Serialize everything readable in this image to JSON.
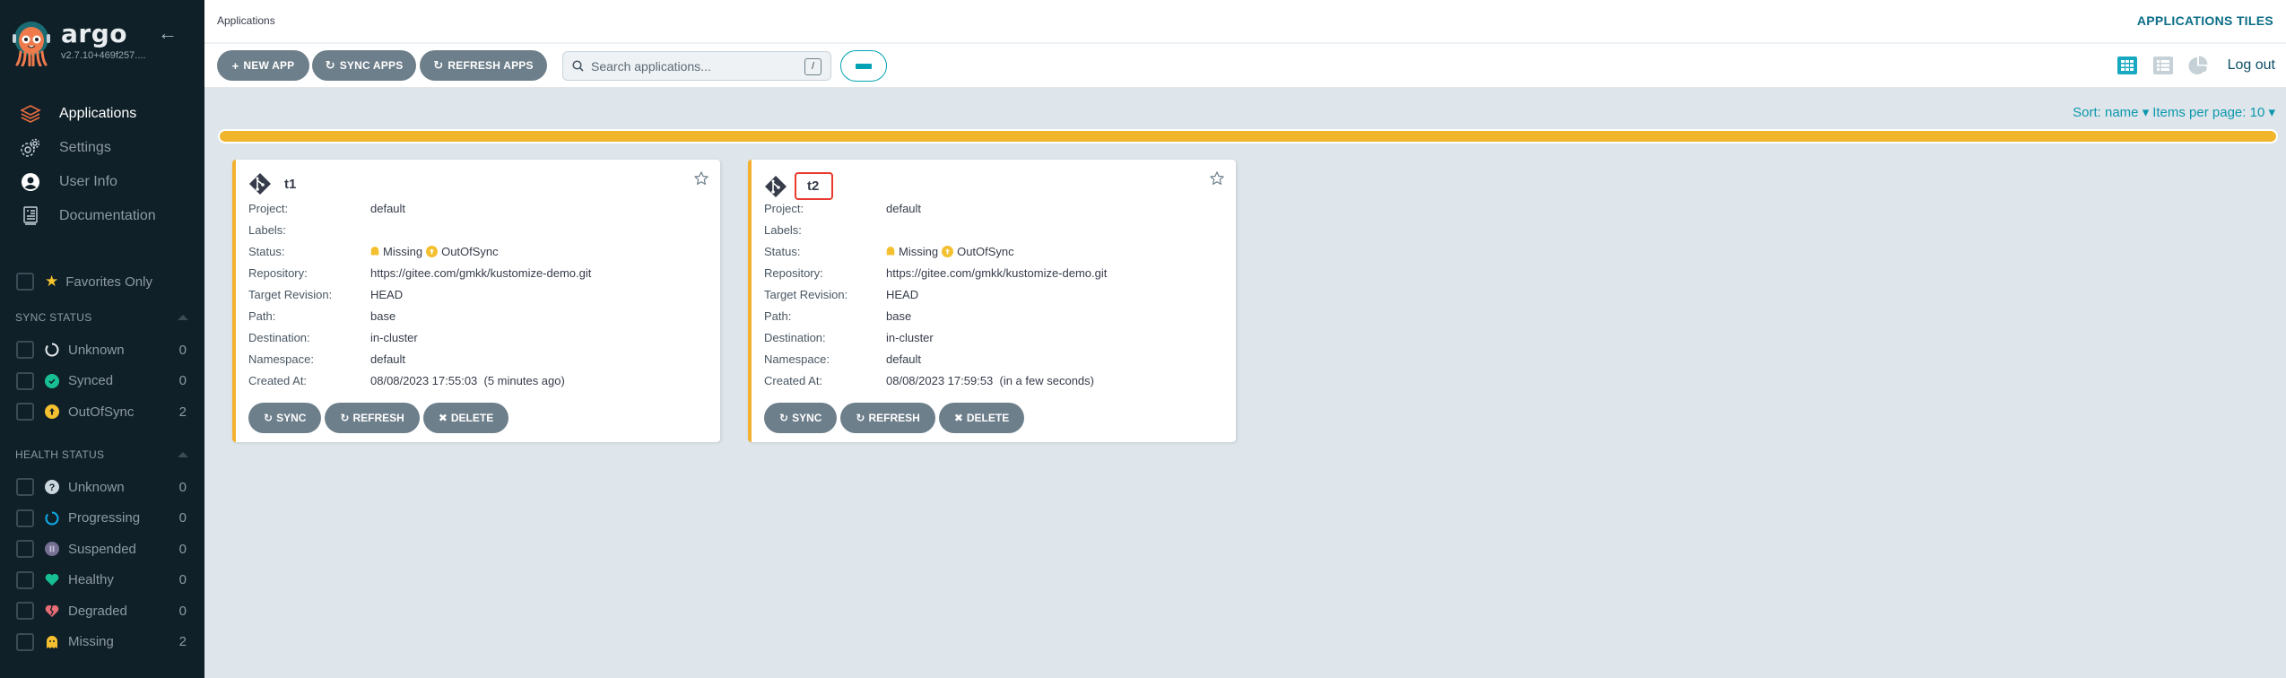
{
  "sidebar": {
    "brand": "argo",
    "version": "v2.7.10+469f257....",
    "nav": [
      {
        "label": "Applications",
        "icon": "layers-icon",
        "active": true
      },
      {
        "label": "Settings",
        "icon": "gears-icon",
        "active": false
      },
      {
        "label": "User Info",
        "icon": "user-circle-icon",
        "active": false
      },
      {
        "label": "Documentation",
        "icon": "book-icon",
        "active": false
      }
    ],
    "favorites_label": "Favorites Only",
    "sync_status": {
      "title": "SYNC STATUS",
      "items": [
        {
          "label": "Unknown",
          "count": "0",
          "icon": "circle-notch-icon"
        },
        {
          "label": "Synced",
          "count": "0",
          "icon": "check-circle-icon"
        },
        {
          "label": "OutOfSync",
          "count": "2",
          "icon": "arrow-circle-up-icon"
        }
      ]
    },
    "health_status": {
      "title": "HEALTH STATUS",
      "items": [
        {
          "label": "Unknown",
          "count": "0",
          "icon": "question-circle-icon"
        },
        {
          "label": "Progressing",
          "count": "0",
          "icon": "spinner-icon"
        },
        {
          "label": "Suspended",
          "count": "0",
          "icon": "pause-circle-icon"
        },
        {
          "label": "Healthy",
          "count": "0",
          "icon": "heart-icon"
        },
        {
          "label": "Degraded",
          "count": "0",
          "icon": "heart-broken-icon"
        },
        {
          "label": "Missing",
          "count": "2",
          "icon": "ghost-icon"
        }
      ]
    }
  },
  "topbar": {
    "breadcrumb": "Applications",
    "title": "APPLICATIONS TILES"
  },
  "toolbar": {
    "new_app": "NEW APP",
    "sync_apps": "SYNC APPS",
    "refresh_apps": "REFRESH APPS",
    "search_placeholder": "Search applications...",
    "search_value": "",
    "search_shortcut": "/",
    "logout": "Log out",
    "views": [
      "tiles",
      "list",
      "summary"
    ],
    "active_view": "tiles"
  },
  "content": {
    "sort_label": "Sort: name",
    "items_per_page_label": "Items per page: 10",
    "status_bar_color": "#f0b52a",
    "status_bar_fraction": 1.0
  },
  "apps": [
    {
      "name": "t1",
      "fields": [
        {
          "key": "Project:",
          "value": "default"
        },
        {
          "key": "Labels:",
          "value": ""
        },
        {
          "key": "Status:",
          "health": "Missing",
          "sync": "OutOfSync"
        },
        {
          "key": "Repository:",
          "value": "https://gitee.com/gmkk/kustomize-demo.git"
        },
        {
          "key": "Target Revision:",
          "value": "HEAD"
        },
        {
          "key": "Path:",
          "value": "base"
        },
        {
          "key": "Destination:",
          "value": "in-cluster"
        },
        {
          "key": "Namespace:",
          "value": "default"
        },
        {
          "key": "Created At:",
          "value": "08/08/2023 17:55:03  (5 minutes ago)"
        }
      ],
      "actions": [
        "SYNC",
        "REFRESH",
        "DELETE"
      ],
      "highlighted": false
    },
    {
      "name": "t2",
      "fields": [
        {
          "key": "Project:",
          "value": "default"
        },
        {
          "key": "Labels:",
          "value": ""
        },
        {
          "key": "Status:",
          "health": "Missing",
          "sync": "OutOfSync"
        },
        {
          "key": "Repository:",
          "value": "https://gitee.com/gmkk/kustomize-demo.git"
        },
        {
          "key": "Target Revision:",
          "value": "HEAD"
        },
        {
          "key": "Path:",
          "value": "base"
        },
        {
          "key": "Destination:",
          "value": "in-cluster"
        },
        {
          "key": "Namespace:",
          "value": "default"
        },
        {
          "key": "Created At:",
          "value": "08/08/2023 17:59:53  (in a few seconds)"
        }
      ],
      "actions": [
        "SYNC",
        "REFRESH",
        "DELETE"
      ],
      "highlighted": true
    }
  ],
  "colors": {
    "accent": "#00a2b3",
    "warning": "#f4b12f",
    "synced": "#18be94",
    "degraded": "#e96d76",
    "suspended": "#766f94",
    "progressing": "#0dadea"
  }
}
